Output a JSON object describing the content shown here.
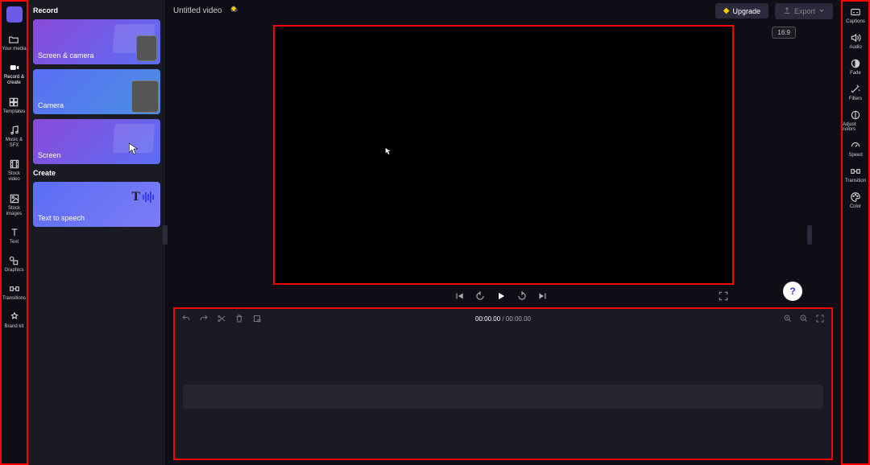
{
  "app": {
    "title": "Untitled video"
  },
  "leftRail": [
    {
      "id": "your-media",
      "label": "Your media"
    },
    {
      "id": "record-create",
      "label": "Record & create"
    },
    {
      "id": "templates",
      "label": "Templates"
    },
    {
      "id": "music-sfx",
      "label": "Music & SFX"
    },
    {
      "id": "stock-video",
      "label": "Stock video"
    },
    {
      "id": "stock-images",
      "label": "Stock images"
    },
    {
      "id": "text",
      "label": "Text"
    },
    {
      "id": "graphics",
      "label": "Graphics"
    },
    {
      "id": "transitions",
      "label": "Transitions"
    },
    {
      "id": "brand-kit",
      "label": "Brand kit"
    }
  ],
  "sidePanel": {
    "recordHeading": "Record",
    "createHeading": "Create",
    "recordCards": [
      {
        "label": "Screen & camera"
      },
      {
        "label": "Camera"
      },
      {
        "label": "Screen"
      }
    ],
    "createCards": [
      {
        "label": "Text to speech"
      }
    ]
  },
  "topbar": {
    "upgrade": "Upgrade",
    "export": "Export"
  },
  "stage": {
    "aspect": "16:9"
  },
  "timeline": {
    "current": "00:00.00",
    "total": "00:00.00",
    "separator": " / "
  },
  "rightRail": [
    {
      "id": "captions",
      "label": "Captions"
    },
    {
      "id": "audio",
      "label": "Audio"
    },
    {
      "id": "fade",
      "label": "Fade"
    },
    {
      "id": "filters",
      "label": "Filters"
    },
    {
      "id": "adjust-colors",
      "label": "Adjust colors"
    },
    {
      "id": "speed",
      "label": "Speed"
    },
    {
      "id": "transition",
      "label": "Transition"
    },
    {
      "id": "color",
      "label": "Color"
    }
  ],
  "help": "?"
}
